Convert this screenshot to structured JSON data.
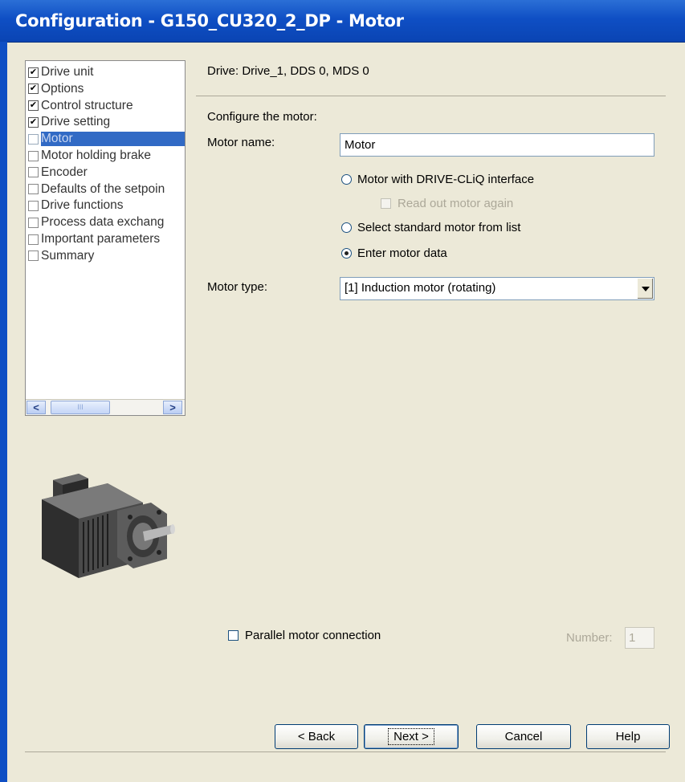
{
  "window": {
    "title": "Configuration - G150_CU320_2_DP - Motor"
  },
  "tree": {
    "items": [
      {
        "label": "Drive unit",
        "checked": true
      },
      {
        "label": "Options",
        "checked": true
      },
      {
        "label": "Control structure",
        "checked": true
      },
      {
        "label": "Drive setting",
        "checked": true
      },
      {
        "label": "Motor",
        "checked": false,
        "selected": true
      },
      {
        "label": "Motor holding brake",
        "checked": false
      },
      {
        "label": "Encoder",
        "checked": false
      },
      {
        "label": "Defaults of the setpoin",
        "checked": false
      },
      {
        "label": "Drive functions",
        "checked": false
      },
      {
        "label": "Process data exchang",
        "checked": false
      },
      {
        "label": "Important parameters",
        "checked": false
      },
      {
        "label": "Summary",
        "checked": false
      }
    ],
    "scroll_left_icon": "<",
    "scroll_right_icon": ">",
    "scroll_grip": "III"
  },
  "header": {
    "drive_info": "Drive: Drive_1, DDS 0, MDS 0"
  },
  "form": {
    "section_label": "Configure the motor:",
    "motor_name_label": "Motor name:",
    "motor_name_value": "Motor",
    "radio_drive_cliq": "Motor with DRIVE-CLiQ interface",
    "checkbox_read_out": "Read out motor again",
    "radio_standard_list": "Select standard motor from list",
    "radio_enter_data": "Enter motor data",
    "selected_radio": "enter_data",
    "motor_type_label": "Motor type:",
    "motor_type_value": "[1] Induction motor (rotating)",
    "parallel_label": "Parallel motor connection",
    "parallel_checked": false,
    "number_label": "Number:",
    "number_value": "1"
  },
  "buttons": {
    "back": "< Back",
    "next": "Next >",
    "cancel": "Cancel",
    "help": "Help"
  },
  "colors": {
    "titlebar": "#0f4fc4",
    "selection": "#316ac5",
    "dialog_bg": "#ece9d8"
  },
  "icons": {
    "motor_picture": "motor-image"
  }
}
